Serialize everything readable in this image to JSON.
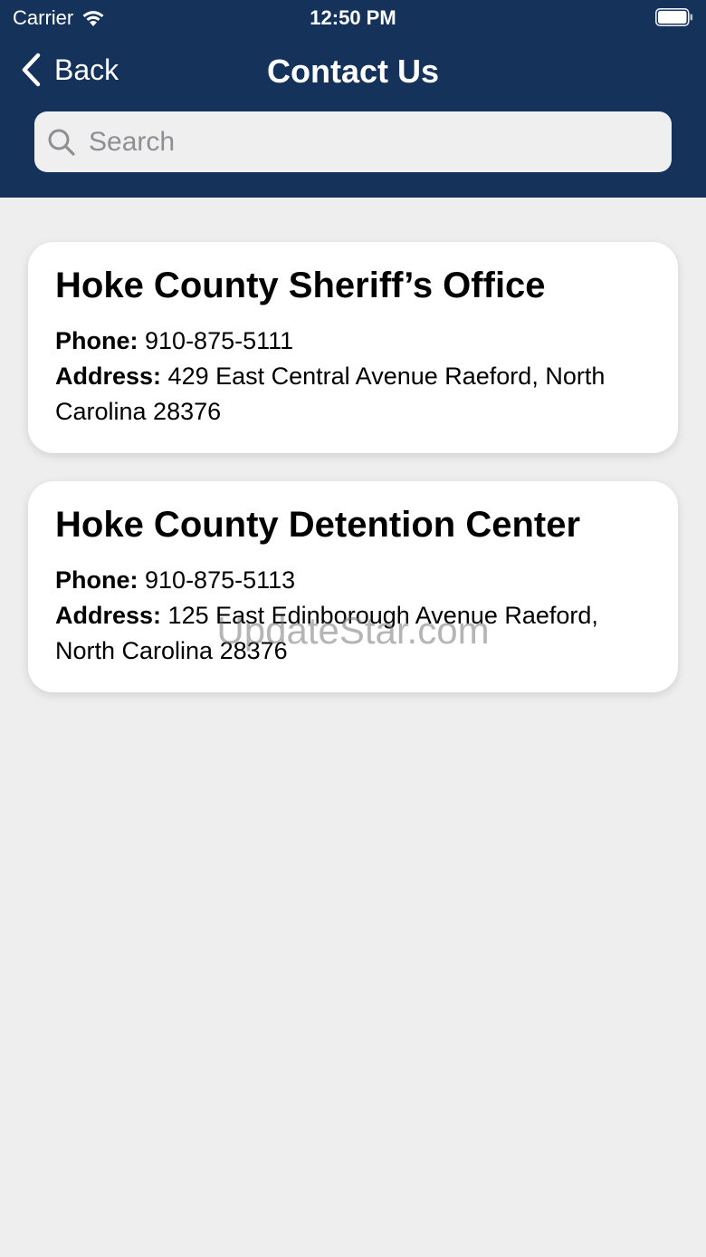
{
  "status_bar": {
    "carrier": "Carrier",
    "time": "12:50 PM"
  },
  "nav": {
    "back_label": "Back",
    "title": "Contact Us"
  },
  "search": {
    "placeholder": "Search"
  },
  "contacts": [
    {
      "name": "Hoke County Sheriff’s Office",
      "phone_label": "Phone:",
      "phone": "910-875-5111",
      "address_label": "Address:",
      "address": "429 East Central Avenue  Raeford, North Carolina 28376"
    },
    {
      "name": "Hoke County Detention Center",
      "phone_label": "Phone:",
      "phone": "910-875-5113",
      "address_label": "Address:",
      "address": "125 East Edinborough Avenue Raeford, North Carolina 28376"
    }
  ],
  "watermark": "UpdateStar.com",
  "colors": {
    "header_bg": "#15325b",
    "page_bg": "#eeeeee",
    "card_bg": "#ffffff"
  }
}
